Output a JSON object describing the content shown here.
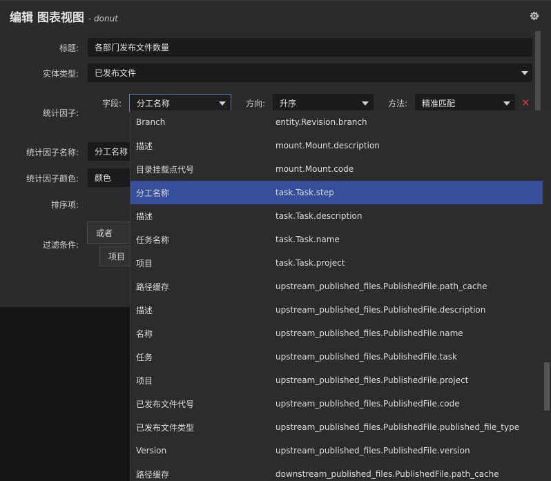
{
  "header": {
    "title": "编辑 图表视图",
    "subtitle": "- donut",
    "settings_icon": "gear-icon"
  },
  "form": {
    "title_label": "标题:",
    "title_value": "各部门发布文件数量",
    "entity_type_label": "实体类型:",
    "entity_type_value": "已发布文件",
    "factor_label": "统计因子:",
    "field_label": "字段:",
    "field_value": "分工名称",
    "direction_label": "方向:",
    "direction_value": "升序",
    "method_label": "方法:",
    "method_value": "精准匹配",
    "factor_name_label": "统计因子名称:",
    "factor_name_value": "分工名称",
    "factor_color_label": "统计因子颜色:",
    "factor_color_value": "颜色",
    "sort_label": "排序项:",
    "filter_label": "过滤条件:",
    "filter_logic_value": "或者",
    "filter_item_value": "项目"
  },
  "dropdown": {
    "selected_index": 3,
    "items": [
      {
        "name": "Branch",
        "path": "entity.Revision.branch"
      },
      {
        "name": "描述",
        "path": "mount.Mount.description"
      },
      {
        "name": "目录挂载点代号",
        "path": "mount.Mount.code"
      },
      {
        "name": "分工名称",
        "path": "task.Task.step"
      },
      {
        "name": "描述",
        "path": "task.Task.description"
      },
      {
        "name": "任务名称",
        "path": "task.Task.name"
      },
      {
        "name": "项目",
        "path": "task.Task.project"
      },
      {
        "name": "路径缓存",
        "path": "upstream_published_files.PublishedFile.path_cache"
      },
      {
        "name": "描述",
        "path": "upstream_published_files.PublishedFile.description"
      },
      {
        "name": "名称",
        "path": "upstream_published_files.PublishedFile.name"
      },
      {
        "name": "任务",
        "path": "upstream_published_files.PublishedFile.task"
      },
      {
        "name": "项目",
        "path": "upstream_published_files.PublishedFile.project"
      },
      {
        "name": "已发布文件代号",
        "path": "upstream_published_files.PublishedFile.code"
      },
      {
        "name": "已发布文件类型",
        "path": "upstream_published_files.PublishedFile.published_file_type"
      },
      {
        "name": "Version",
        "path": "upstream_published_files.PublishedFile.version"
      },
      {
        "name": "路径缓存",
        "path": "downstream_published_files.PublishedFile.path_cache"
      }
    ]
  },
  "colors": {
    "selection": "#354f9a",
    "remove": "#d23a3a",
    "panel": "#2b2b2b",
    "field": "#1b1b1b"
  }
}
